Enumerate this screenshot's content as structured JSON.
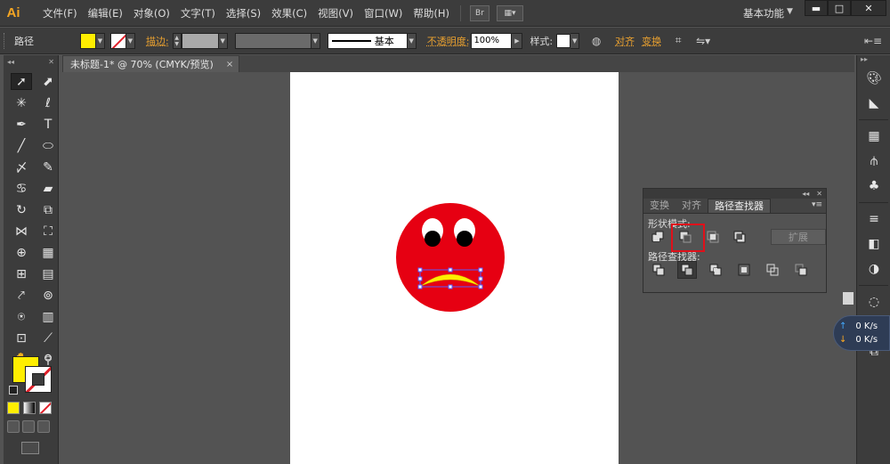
{
  "app": {
    "logo": "Ai",
    "workspace": "基本功能"
  },
  "menu": [
    "文件(F)",
    "编辑(E)",
    "对象(O)",
    "文字(T)",
    "选择(S)",
    "效果(C)",
    "视图(V)",
    "窗口(W)",
    "帮助(H)"
  ],
  "menubar_buttons": {
    "bridge": "Br"
  },
  "window_controls": {
    "minimize": "▬",
    "maximize": "□",
    "close": "✕"
  },
  "controlbar": {
    "selection_label": "路径",
    "stroke_label": "描边:",
    "stroke_profile": "基本",
    "opacity_label": "不透明度:",
    "opacity_value": "100%",
    "style_label": "样式:",
    "align_label": "对齐",
    "transform_label": "变换",
    "fill_color": "#ffee00"
  },
  "document": {
    "tab_title": "未标题-1* @ 70% (CMYK/预览)",
    "close": "×"
  },
  "pathfinder": {
    "tabs": [
      "变换",
      "对齐",
      "路径查找器"
    ],
    "active_tab": "路径查找器",
    "shape_modes_label": "形状模式:",
    "pathfinders_label": "路径查找器:",
    "expand_label": "扩展",
    "shape_mode_buttons": [
      "unite-icon",
      "minus-front-icon",
      "intersect-icon",
      "exclude-icon"
    ],
    "pathfinder_buttons": [
      "divide-icon",
      "trim-icon",
      "merge-icon",
      "crop-icon",
      "outline-icon",
      "minus-back-icon"
    ],
    "highlighted_button": "minus-front-icon"
  },
  "netspeed": {
    "upload": "0 K/s",
    "download": "0 K/s"
  },
  "colors": {
    "face": "#e60012",
    "mouth": "#ffee00",
    "selection": "#5a5aff",
    "highlight": "#e0101a"
  }
}
